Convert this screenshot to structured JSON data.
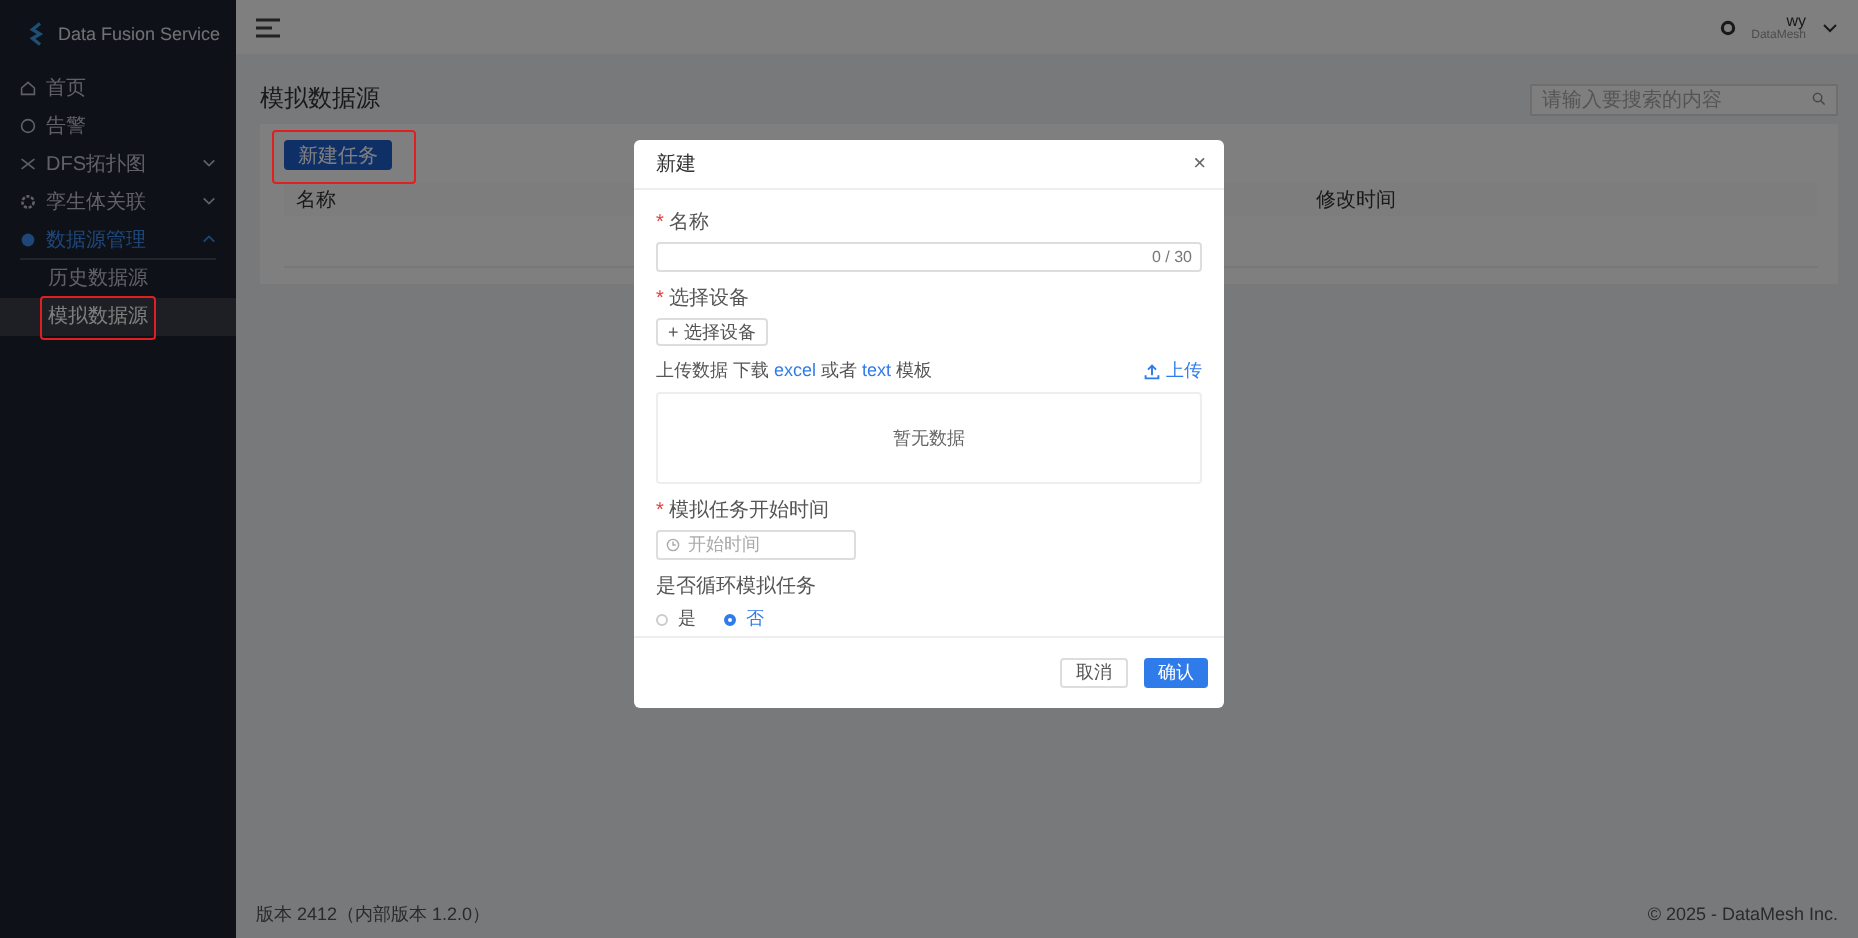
{
  "app": {
    "title": "Data Fusion Service"
  },
  "sidebar": {
    "items": [
      {
        "label": "首页",
        "selected": false
      },
      {
        "label": "告警",
        "selected": false
      },
      {
        "label": "DFS拓扑图",
        "selected": false,
        "expanded": false
      },
      {
        "label": "孪生体关联",
        "selected": false,
        "expanded": false
      },
      {
        "label": "数据源管理",
        "selected": true,
        "expanded": true,
        "children": [
          {
            "label": "历史数据源",
            "selected": false,
            "highlighted": false
          },
          {
            "label": "模拟数据源",
            "selected": true,
            "highlighted": true
          }
        ]
      }
    ]
  },
  "header": {
    "user": "wy",
    "user_subtitle": "DataMesh"
  },
  "page": {
    "title": "模拟数据源",
    "search": {
      "placeholder": "请输入要搜索的内容"
    },
    "new_button": {
      "label": "新建任务",
      "highlighted": true
    },
    "table": {
      "columns": [
        "名称",
        "修改时间"
      ]
    }
  },
  "dialog": {
    "title": "新建",
    "close": "×",
    "name_field": {
      "label": "名称",
      "required_mark": "*",
      "counter": "0 / 30"
    },
    "device": {
      "label": "选择设备",
      "required_mark": "*",
      "button": "+ 选择设备"
    },
    "upload": {
      "parts": [
        "上传数据 下载 ",
        "excel",
        " 或者 ",
        "text",
        " 模板"
      ],
      "button": "上传",
      "empty": "暂无数据"
    },
    "start_time": {
      "label": "模拟任务开始时间",
      "required_mark": "*",
      "placeholder": "开始时间"
    },
    "loop": {
      "label": "是否循环模拟任务",
      "options": [
        {
          "label": "是",
          "selected": false
        },
        {
          "label": "否",
          "selected": true
        }
      ]
    },
    "buttons": {
      "cancel": "取消",
      "confirm": "确认"
    }
  },
  "footer": {
    "version": "版本 2412（内部版本 1.2.0）",
    "copyright": "© 2025 - DataMesh Inc."
  }
}
